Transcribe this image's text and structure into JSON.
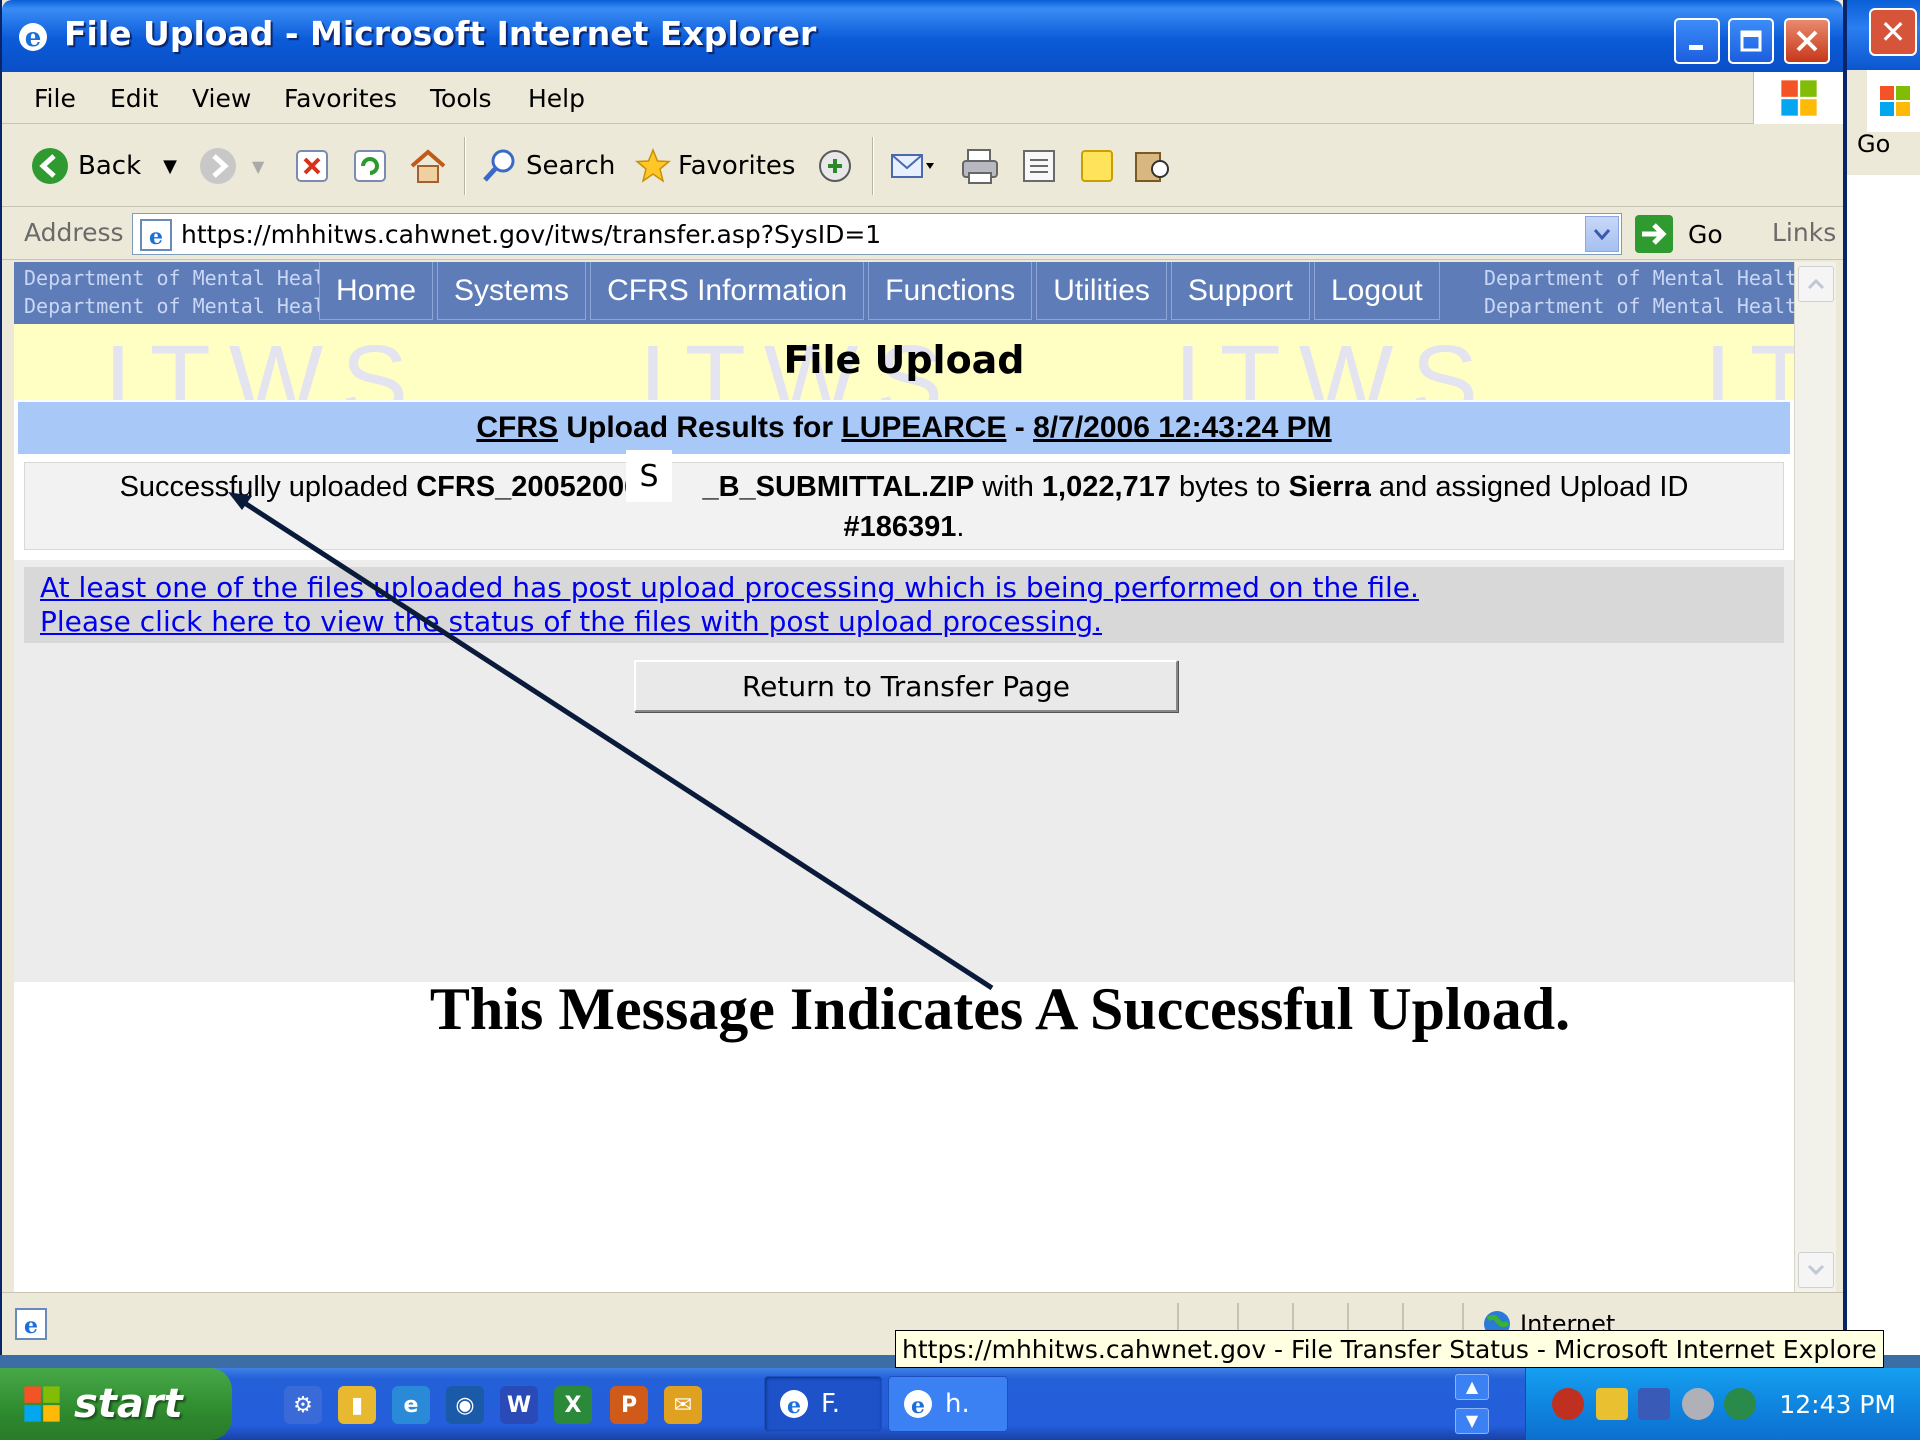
{
  "window": {
    "title": "File Upload - Microsoft Internet Explorer"
  },
  "menu": [
    "File",
    "Edit",
    "View",
    "Favorites",
    "Tools",
    "Help"
  ],
  "toolbar": {
    "back_label": "Back",
    "search_label": "Search",
    "favorites_label": "Favorites"
  },
  "address": {
    "label": "Address",
    "url": "https://mhhitws.cahwnet.gov/itws/transfer.asp?SysID=1",
    "go_label": "Go",
    "links_label": "Links"
  },
  "background_window": {
    "go_label": "Go"
  },
  "page": {
    "dept_text": "Department of Mental Health",
    "nav_tabs": [
      "Home",
      "Systems",
      "CFRS Information",
      "Functions",
      "Utilities",
      "Support",
      "Logout"
    ],
    "watermark": "ITWS",
    "title": "File Upload",
    "results": {
      "system": "CFRS",
      "prefix": "Upload Results for",
      "user": "LUPEARCE",
      "separator": "-",
      "datetime": "8/7/2006 12:43:24 PM"
    },
    "success": {
      "pre": "Successfully uploaded",
      "file_start": "CFRS_20052006_",
      "file_end": "_B_SUBMITTAL.ZIP",
      "with": "with",
      "bytes": "1,022,717",
      "bytes_to": "bytes to",
      "county": "Sierra",
      "assigned": "and assigned Upload ID",
      "upload_id": "#186391",
      "period": "."
    },
    "post_upload_line1": "At least one of the files uploaded has post upload processing which is being performed on the file.",
    "post_upload_line2": "Please click here to view the status of the files with post upload processing.",
    "return_button": "Return to Transfer Page"
  },
  "annotation": {
    "callout_letter": "S",
    "caption": "This Message Indicates A Successful Upload."
  },
  "statusbar": {
    "zone": "Internet"
  },
  "tooltip": "https://mhhitws.cahwnet.gov - File Transfer Status - Microsoft Internet Explore",
  "taskbar": {
    "start_label": "start",
    "task_buttons": [
      "F.",
      "h."
    ],
    "clock": "12:43 PM"
  }
}
